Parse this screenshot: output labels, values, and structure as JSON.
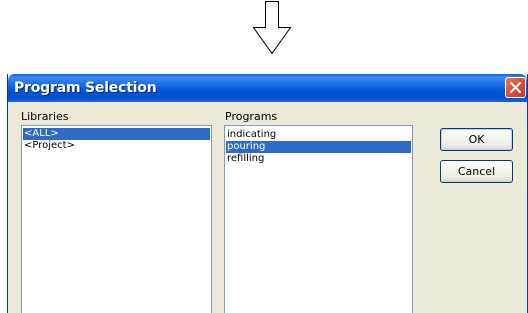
{
  "flow_arrow_icon": "down-arrow-icon",
  "dialog": {
    "title": "Program Selection",
    "close_icon": "close-icon",
    "colors": {
      "title_bar": "#0054e3",
      "selection": "#316ac5",
      "face": "#ece9d8"
    }
  },
  "libraries": {
    "label": "Libraries",
    "items": [
      {
        "text": "<ALL>",
        "selected": true
      },
      {
        "text": "<Project>",
        "selected": false
      }
    ]
  },
  "programs": {
    "label": "Programs",
    "items": [
      {
        "text": "indicating",
        "selected": false
      },
      {
        "text": "pouring",
        "selected": true
      },
      {
        "text": "refilling",
        "selected": false
      }
    ]
  },
  "buttons": {
    "ok": "OK",
    "cancel": "Cancel"
  }
}
